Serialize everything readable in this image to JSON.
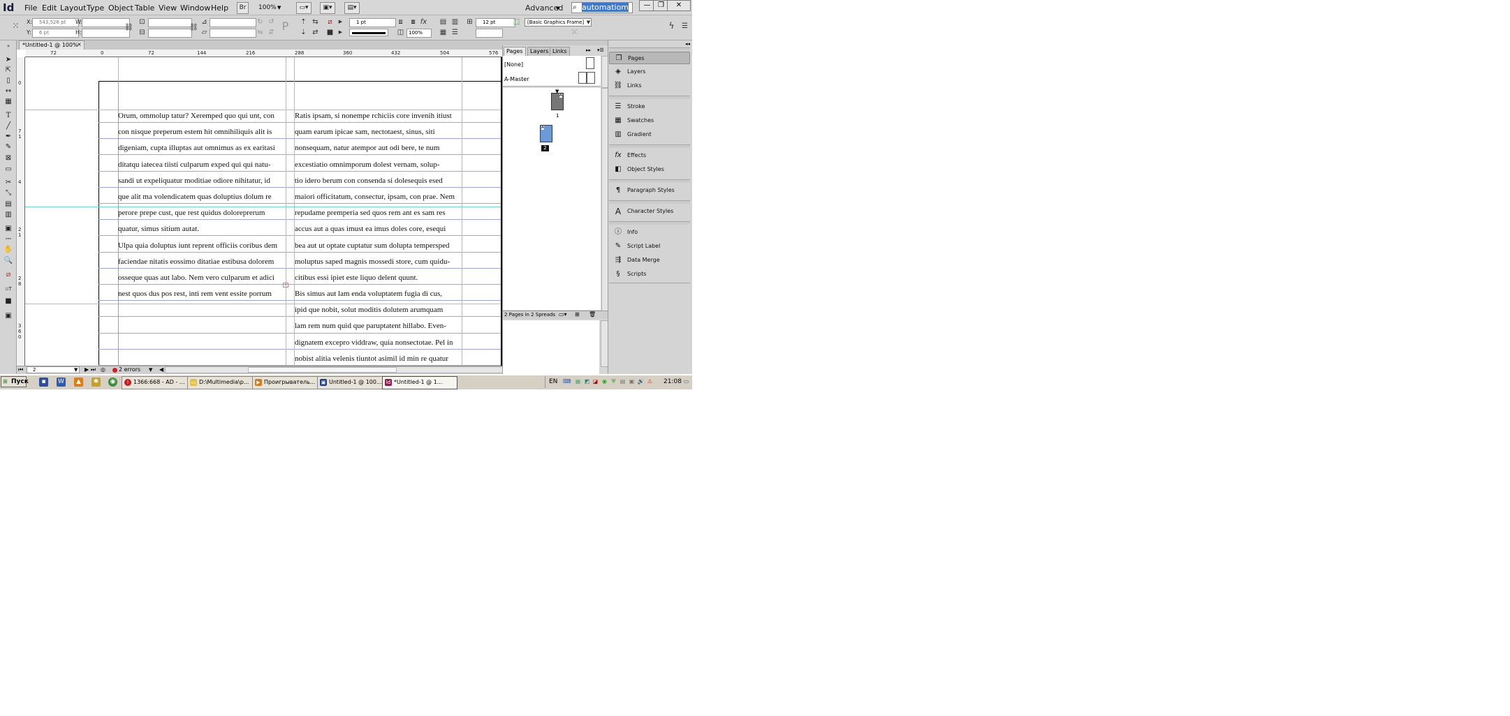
{
  "app": {
    "logo": "Id"
  },
  "menu": {
    "items": [
      "File",
      "Edit",
      "Layout",
      "Type",
      "Object",
      "Table",
      "View",
      "Window",
      "Help"
    ],
    "bridge_label": "Br",
    "zoom": "100%",
    "workspace": "Advanced",
    "search_value": "automatiom"
  },
  "control": {
    "x_label": "X:",
    "x_value": "543,526 pt",
    "y_label": "Y:",
    "y_value": "6 pt",
    "w_label": "W:",
    "h_label": "H:",
    "stroke_weight": "1 pt",
    "scale_percent": "100%",
    "text_size": "12 pt",
    "object_style": "[Basic Graphics Frame]"
  },
  "document": {
    "tab_title": "*Untitled-1 @ 100%",
    "tab_close": "×",
    "ruler_h": [
      "72",
      "0",
      "72",
      "144",
      "216",
      "288",
      "360",
      "432",
      "504",
      "576"
    ],
    "ruler_v": [
      "0",
      "7",
      "1",
      "4",
      "2",
      "1",
      "2",
      "8",
      "3",
      "6",
      "0"
    ],
    "column1": [
      "Orum, ommolup tatur? Xeremped quo qui unt, con",
      "con nisque preperum estem hit omnihiliquis alit is",
      "digeniam, cupta illuptas aut omnimus as ex earitasi",
      "ditatqu iatecea tiisti culparum exped qui qui natu-",
      "sandi ut expeliquatur moditiae odiore nihitatur, id",
      "que alit ma volendicatem quas doluptius dolum re",
      "perore prepe cust, que rest quidus doloreprerum",
      "quatur, simus sitium autat.",
      "Ulpa quia doluptus iunt reprent officiis coribus dem",
      "faciendae nitatis eossimo ditatiae estibusa dolorem",
      "osseque quas aut labo. Nem vero culparum et adici",
      "nest quos dus pos rest, inti rem vent essite porrum"
    ],
    "column2": [
      "Ratis ipsam, si nonempe rchiciis core invenih itiust",
      "quam earum ipicae sam, nectotaest, sinus, siti",
      "nonsequam, natur atempor aut odi bere, te num",
      "excestiatio omnimporum dolest vernam, solup-",
      "tio idero berum con consenda si dolesequis esed",
      "maiori officitatum, consectur, ipsam, con prae. Nem",
      "repudame premperia sed quos rem ant es sam res",
      "accus aut a quas imust ea imus doles core, esequi",
      "bea aut ut optate cuptatur sum dolupta tempersped",
      "moluptus saped magnis mossedi store, cum quidu-",
      "citibus essi ipiet este liquo delent quunt.",
      "Bis simus aut lam enda voluptatem fugia di cus,",
      "ipid que nobit, solut moditis dolutem arumquam",
      "lam rem num quid que paruptatent hillabo. Even-",
      "dignatem excepro viddraw, quia nonsectotae. Pel in",
      "nobist alitia velenis tiuntot asimil id min re quatur"
    ],
    "page_field": "2",
    "errors": "2 errors"
  },
  "pages_panel": {
    "tabs": [
      "Pages",
      "Layers",
      "Links"
    ],
    "none_master": "[None]",
    "a_master": "A-Master",
    "page1_label": "1",
    "page2_label": "2",
    "master_letter": "A",
    "footer": "2 Pages in 2 Spreads"
  },
  "dock": {
    "items": [
      "Pages",
      "Layers",
      "Links",
      "Stroke",
      "Swatches",
      "Gradient",
      "Effects",
      "Object Styles",
      "Paragraph Styles",
      "Character Styles",
      "Info",
      "Script Label",
      "Data Merge",
      "Scripts"
    ]
  },
  "taskbar": {
    "start": "Пуск",
    "tasks": [
      "1366:668 - AD - ...",
      "D:\\Multimedia\\p...",
      "Проигрыватель...",
      "Untitled-1 @ 100...",
      "*Untitled-1 @ 1..."
    ],
    "language": "EN",
    "clock": "21:08"
  }
}
